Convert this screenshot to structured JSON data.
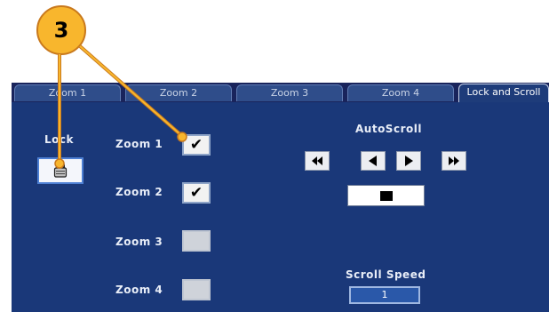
{
  "callout": {
    "number": "3"
  },
  "tabs": [
    {
      "label": "Zoom 1",
      "active": false
    },
    {
      "label": "Zoom 2",
      "active": false
    },
    {
      "label": "Zoom 3",
      "active": false
    },
    {
      "label": "Zoom 4",
      "active": false
    },
    {
      "label": "Lock and Scroll",
      "active": true
    }
  ],
  "lock": {
    "label": "Lock",
    "icon": "padlock-icon"
  },
  "zooms": [
    {
      "label": "Zoom 1",
      "checked": true
    },
    {
      "label": "Zoom 2",
      "checked": true
    },
    {
      "label": "Zoom 3",
      "checked": false
    },
    {
      "label": "Zoom 4",
      "checked": false
    }
  ],
  "checkmark": "✔",
  "autoscroll": {
    "label": "AutoScroll",
    "buttons": [
      "fast-rewind-icon",
      "play-left-icon",
      "play-right-icon",
      "fast-forward-icon"
    ],
    "stop_icon": "stop-icon"
  },
  "scroll_speed": {
    "label": "Scroll Speed",
    "value": "1"
  },
  "colors": {
    "panel": "#1a3879",
    "tabstrip": "#19245c",
    "callout": "#f8b62d",
    "leader": "#e89a2a"
  }
}
